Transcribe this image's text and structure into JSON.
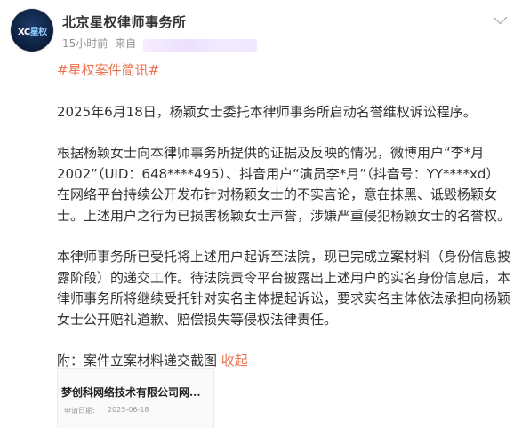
{
  "author": {
    "name": "北京星权律师事务所",
    "avatar_logo_prefix": "XC",
    "avatar_logo_suffix": "星权",
    "time": "15小时前",
    "source_prefix": "来自"
  },
  "post": {
    "topic": "#星权案件简讯#",
    "paragraphs": [
      "2025年6月18日，杨颖女士委托本律师事务所启动名誉维权诉讼程序。",
      "根据杨颖女士向本律师事务所提供的证据及反映的情况，微博用户“李*月2002”（UID：648****495）、抖音用户“演员李*月”（抖音号：YY****xd）在网络平台持续公开发布针对杨颖女士的不实言论，意在抹黑、诋毁杨颖女士。上述用户之行为已损害杨颖女士声誉，涉嫌严重侵犯杨颖女士的名誉权。",
      "本律师事务所已受托将上述用户起诉至法院，现已完成立案材料（身份信息披露阶段）的递交工作。待法院责令平台披露出上述用户的实名身份信息后，本律师事务所将继续受托针对实名主体提起诉讼，要求实名主体依法承担向杨颖女士公开赔礼道歉、赔偿损失等侵权法律责任。"
    ],
    "attachment_text": "附：案件立案材料递交截图",
    "collapse_link": "收起"
  },
  "thumbnail": {
    "title": "梦创科网络技术有限公司网...",
    "date_label": "申请日期:",
    "date": "2025-06-18"
  }
}
